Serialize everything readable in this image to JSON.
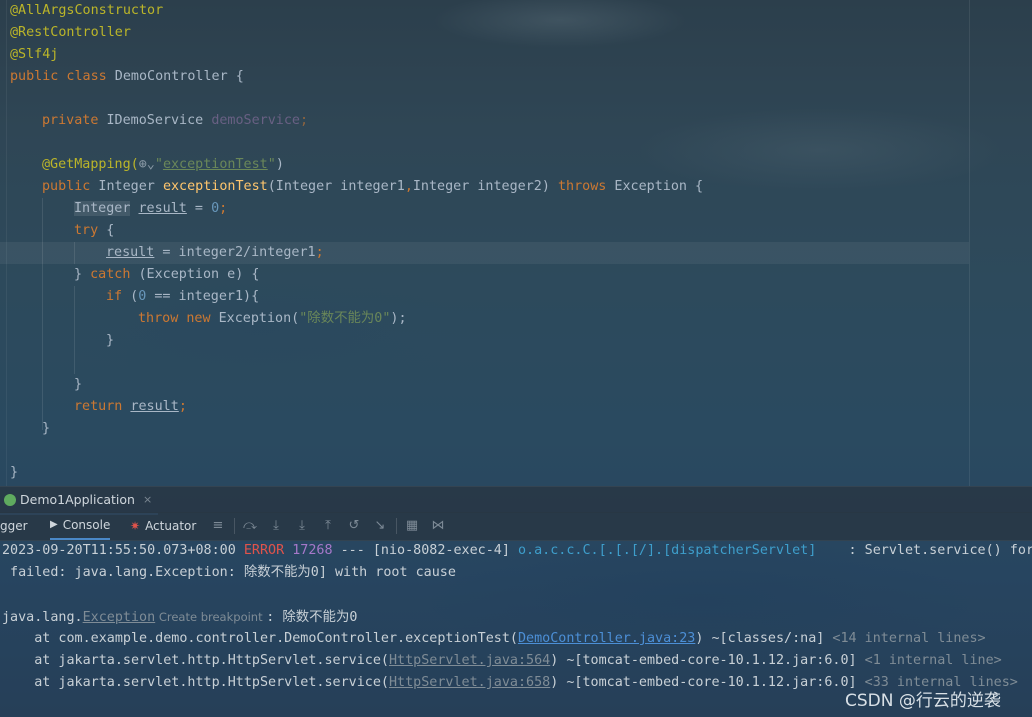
{
  "code": {
    "l1": "@AllArgsConstructor",
    "l2": "@RestController",
    "l3": "@Slf4j",
    "l4_kw": "public class",
    "l4_rest": " DemoController {",
    "l6_kw": "private",
    "l6_type": " IDemoService ",
    "l6_field": "demoService",
    "l6_semi": ";",
    "l8_ann": "@GetMapping(",
    "l8_icon": "⊕⌄",
    "l8_q1": "\"",
    "l8_str": "exceptionTest",
    "l8_q2": "\"",
    "l8_end": ")",
    "l9_kw": "public",
    "l9_type": " Integer ",
    "l9_fn": "exceptionTest",
    "l9_params_a": "(Integer integer1",
    "l9_comma": ",",
    "l9_params_b": "Integer integer2) ",
    "l9_throws": "throws",
    "l9_end": " Exception {",
    "l10_type": "Integer",
    "l10_sp": " ",
    "l10_var": "result",
    "l10_eq": " = ",
    "l10_num": "0",
    "l10_semi": ";",
    "l11_kw": "try",
    "l11_end": " {",
    "l12_var": "result",
    "l12_rest": " = integer2/integer1",
    "l12_semi": ";",
    "l13_a": "} ",
    "l13_kw": "catch",
    "l13_rest": " (Exception e) {",
    "l14_kw": "if",
    "l14_a": " (",
    "l14_num": "0",
    "l14_rest": " == integer1){",
    "l15_kw1": "throw",
    "l15_sp": " ",
    "l15_kw2": "new",
    "l15_a": " Exception(",
    "l15_str": "\"除数不能为0\"",
    "l15_end": ");",
    "l16": "}",
    "l18": "}",
    "l19_kw": "return",
    "l19_sp": " ",
    "l19_var": "result",
    "l19_semi": ";",
    "l20": "}",
    "l22": "}"
  },
  "run_tab": {
    "label": "Demo1Application",
    "close": "×"
  },
  "toolbar": {
    "debugger_label": "gger",
    "console_label": "Console",
    "actuator_label": "Actuator"
  },
  "console": {
    "line1": {
      "timestamp": "2023-09-20T11:55:50.073+08:00 ",
      "level": "ERROR",
      "sp": " ",
      "pid": "17268",
      "sep": " --- ",
      "thread": "[nio-8082-exec-4] ",
      "logger": "o.a.c.c.C.[.[.[/].[dispatcherServlet]",
      "msg": "    : Servlet.service() for"
    },
    "line2": " failed: java.lang.Exception: 除数不能为0] with root cause",
    "line4": {
      "prefix": "java.lang.",
      "exc": "Exception",
      "bp": " Create breakpoint ",
      "rest": ": 除数不能为0"
    },
    "line5": {
      "prefix": "    at com.example.demo.controller.DemoController.exceptionTest(",
      "link": "DemoController.java:23",
      "rest": ") ~[classes/:na] ",
      "dim": "<14 internal lines>"
    },
    "line6": {
      "prefix": "    at jakarta.servlet.http.HttpServlet.service(",
      "link": "HttpServlet.java:564",
      "rest": ") ~[tomcat-embed-core-10.1.12.jar:6.0] ",
      "dim": "<1 internal line>"
    },
    "line7": {
      "prefix": "    at jakarta.servlet.http.HttpServlet.service(",
      "link": "HttpServlet.java:658",
      "rest": ") ~[tomcat-embed-core-10.1.12.jar:6.0] ",
      "dim": "<33 internal lines>"
    }
  },
  "watermark": "CSDN @行云的逆袭",
  "colors": {
    "keyword": "#cc7832",
    "annotation": "#bbb529",
    "string": "#6a8759",
    "number": "#6897bb",
    "method": "#ffc66d",
    "error": "#e0534b",
    "link": "#4c8fd6"
  }
}
